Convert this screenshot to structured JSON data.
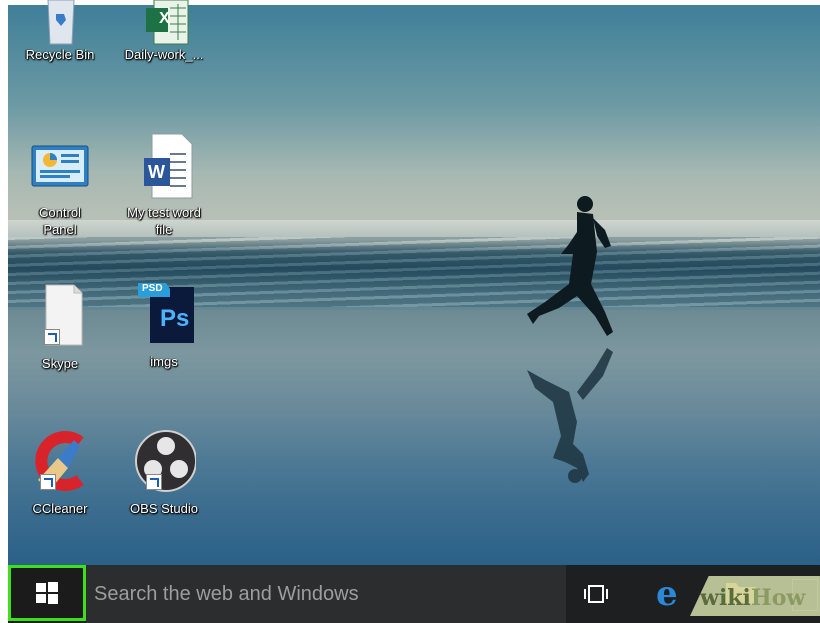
{
  "desktop_icons": [
    {
      "label": "Recycle Bin",
      "icon": "recycle-bin-icon"
    },
    {
      "label": "Daily-work_...",
      "icon": "excel-file-icon",
      "badge": "X"
    },
    {
      "label": "Control Panel",
      "icon": "control-panel-icon"
    },
    {
      "label": "My test word file",
      "icon": "word-file-icon",
      "badge": "W"
    },
    {
      "label": "Skype",
      "icon": "skype-shortcut-icon"
    },
    {
      "label": "imgs",
      "icon": "photoshop-file-icon",
      "badge": "Ps",
      "tag": "PSD"
    },
    {
      "label": "CCleaner",
      "icon": "ccleaner-icon"
    },
    {
      "label": "OBS Studio",
      "icon": "obs-studio-icon"
    }
  ],
  "taskbar": {
    "search_placeholder": "Search the web and Windows",
    "edge_glyph": "e",
    "highlight_color": "#3ee01a"
  },
  "watermark": {
    "wiki": "wiki",
    "how": "How"
  }
}
